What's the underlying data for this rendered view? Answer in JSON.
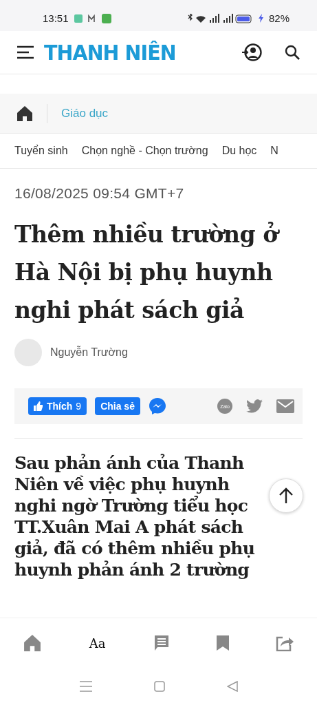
{
  "status_bar": {
    "time": "13:51",
    "battery": "82%"
  },
  "header": {
    "logo": "THANH NIÊN"
  },
  "breadcrumb": {
    "section": "Giáo dục"
  },
  "subnav": [
    {
      "label": "Tuyển sinh"
    },
    {
      "label": "Chọn nghề - Chọn trường"
    },
    {
      "label": "Du học"
    },
    {
      "label": "N"
    }
  ],
  "article": {
    "date": "16/08/2025 09:54 GMT+7",
    "title": "Thêm nhiều trường ở Hà Nội bị phụ huynh nghi phát sách giả",
    "author": "Nguyễn Trường",
    "lead": "Sau phản ánh của Thanh Niên về việc phụ huynh nghi ngờ Trường tiểu học TT.Xuân Mai A phát sách giả, đã có thêm nhiều phụ huynh phản ánh 2 trường"
  },
  "share": {
    "like_label": "Thích",
    "like_count": "9",
    "share_label": "Chia sẻ",
    "zalo_label": "Zalo"
  },
  "bottom_nav": {
    "font_label": "Aa"
  }
}
